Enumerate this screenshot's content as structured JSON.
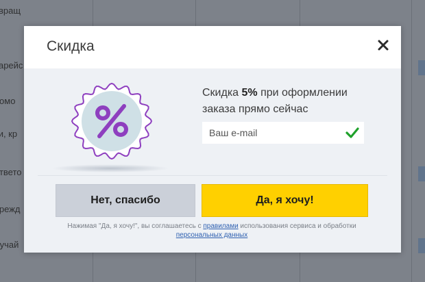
{
  "background": {
    "left_items": [
      "звращ",
      "зарейс",
      "помо",
      "ки, кр",
      "ответо",
      "врежд",
      "лучай"
    ]
  },
  "modal": {
    "title": "Скидка",
    "close_icon": "close-icon",
    "badge_icon": "percent-badge-icon",
    "offer": {
      "prefix": "Скидка ",
      "percent": "5%",
      "suffix": " при оформлении заказа прямо сейчас"
    },
    "email": {
      "placeholder": "Ваш e-mail",
      "value": ""
    },
    "valid_icon": "checkmark-icon",
    "buttons": {
      "no": "Нет, спасибо",
      "yes": "Да, я хочу!"
    },
    "legal": {
      "text1": "Нажимая \"Да, я хочу!\", вы соглашаетесь с ",
      "link_rules": "правилами",
      "text2": " использования сервиса и обработки ",
      "link_data": "персональных данных"
    },
    "colors": {
      "accent_yellow": "#ffd000",
      "badge_purple": "#8e3fbf",
      "check_green": "#1fa12b"
    }
  }
}
